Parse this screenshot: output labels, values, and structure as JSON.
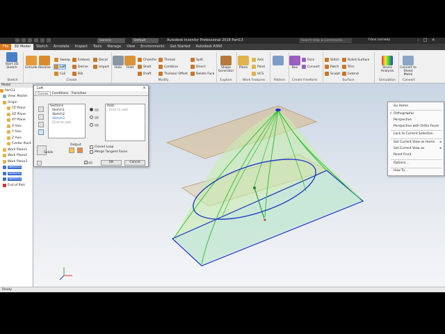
{
  "app": {
    "title": "Autodesk Inventor Professional 2018    Part13",
    "search_placeholder": "Search Help & Commands...",
    "user": "frans.cornody",
    "appearance_combo": "Generic",
    "material_combo": "Default"
  },
  "tabs": [
    "File",
    "3D Model",
    "Sketch",
    "Annotate",
    "Inspect",
    "Tools",
    "Manage",
    "View",
    "Environments",
    "Get Started",
    "Autodesk A360"
  ],
  "ribbon": {
    "sketch": {
      "start_label": "Start 2D Sketch",
      "panel": "Sketch"
    },
    "create": {
      "extrude": "Extrude",
      "revolve": "Revolve",
      "sweep": "Sweep",
      "loft": "Loft",
      "coil": "Coil",
      "emboss": "Emboss",
      "derive": "Derive",
      "rib": "Rib",
      "decal": "Decal",
      "import": "Import",
      "panel": "Create"
    },
    "modify": {
      "hole": "Hole",
      "fillet": "Fillet",
      "chamfer": "Chamfer",
      "shell": "Shell",
      "draft": "Draft",
      "thread": "Thread",
      "combine": "Combine",
      "thicken": "Thicken/ Offset",
      "split": "Split",
      "direct": "Direct",
      "delete_face": "Delete Face",
      "panel": "Modify"
    },
    "explore": {
      "shape_gen": "Shape Generator",
      "panel": "Explore"
    },
    "work": {
      "plane": "Plane",
      "axis": "Axis",
      "point": "Point",
      "ucs": "UCS",
      "panel": "Work Features"
    },
    "pattern": {
      "panel": "Pattern"
    },
    "freeform": {
      "box": "Box",
      "face": "Face",
      "convert": "Convert",
      "panel": "Create Freeform"
    },
    "surface": {
      "stitch": "Stitch",
      "patch": "Patch",
      "sculpt": "Sculpt",
      "ruled": "Ruled Surface",
      "trim": "Trim",
      "extend": "Extend",
      "panel": "Surface"
    },
    "simulation": {
      "stress": "Stress Analysis",
      "panel": "Simulation"
    },
    "convert": {
      "sheet": "Convert to Sheet Metal",
      "panel": "Convert"
    }
  },
  "browser": {
    "header": "Model",
    "items": [
      "Part13",
      "View: Master",
      "Origin",
      "YZ Plane",
      "XZ Plane",
      "XY Plane",
      "X Axis",
      "Y Axis",
      "Z Axis",
      "Center Point",
      "Work Plane1",
      "Work Plane2",
      "Work Plane3",
      "Sketch1",
      "Sketch2",
      "Sketch3",
      "End of Part"
    ]
  },
  "dialog": {
    "title": "Loft",
    "tabs": [
      "Curves",
      "Conditions",
      "Transition"
    ],
    "sections_header": "Sections",
    "sections": [
      "Sketch1",
      "Sketch2",
      "Sketch3"
    ],
    "sections_hint": "Click to add",
    "rails_header": "Rails",
    "rails_hint": "Click to add",
    "output_label": "Output",
    "solids_label": "Solids",
    "closed_loop": "Closed Loop",
    "merge_faces": "Merge Tangent Faces",
    "ok": "OK",
    "cancel": "Cancel"
  },
  "context_menu": {
    "items": [
      "Go Home",
      "Orthographic",
      "Perspective",
      "Perspective with Ortho Faces",
      "Lock to Current Selection",
      "Set Current View as Home",
      "Set Current View as",
      "Reset Front",
      "Options...",
      "How To..."
    ]
  },
  "status": {
    "text": "Ready"
  },
  "colors": {
    "file_tab": "#d9781c",
    "selection_blue": "#3b6fd4",
    "surface_tan": "#d9b98a",
    "surface_green": "#c8ecaf",
    "curve_blue": "#1530c8"
  }
}
